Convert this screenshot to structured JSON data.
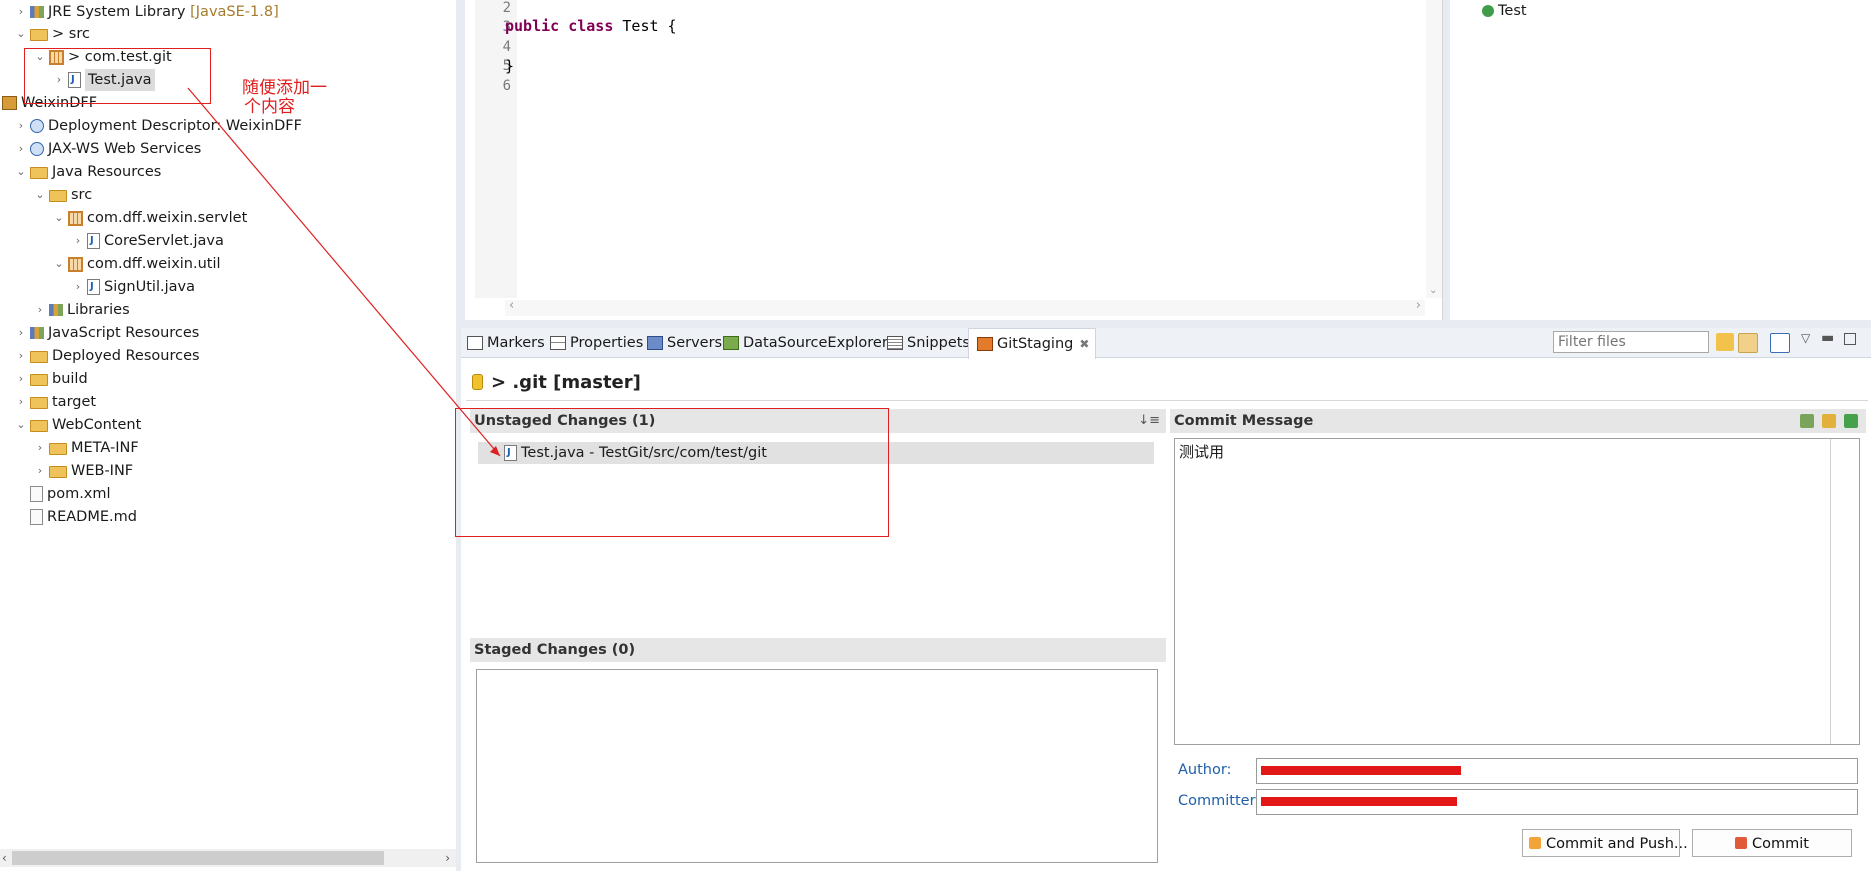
{
  "explorer": {
    "items": [
      {
        "label": "JRE System Library",
        "suffix": "[JavaSE-1.8]"
      },
      {
        "label": "> src"
      },
      {
        "label": "> com.test.git"
      },
      {
        "label": "Test.java"
      },
      {
        "label": "WeixinDFF"
      },
      {
        "label": "Deployment Descriptor: WeixinDFF"
      },
      {
        "label": "JAX-WS Web Services"
      },
      {
        "label": "Java Resources"
      },
      {
        "label": "src"
      },
      {
        "label": "com.dff.weixin.servlet"
      },
      {
        "label": "CoreServlet.java"
      },
      {
        "label": "com.dff.weixin.util"
      },
      {
        "label": "SignUtil.java"
      },
      {
        "label": "Libraries"
      },
      {
        "label": "JavaScript Resources"
      },
      {
        "label": "Deployed Resources"
      },
      {
        "label": "build"
      },
      {
        "label": "target"
      },
      {
        "label": "WebContent"
      },
      {
        "label": "META-INF"
      },
      {
        "label": "WEB-INF"
      },
      {
        "label": "pom.xml"
      },
      {
        "label": "README.md"
      }
    ]
  },
  "annotation": {
    "text_line1": "随便添加一",
    "text_line2": "个内容"
  },
  "editor": {
    "line_numbers": [
      "2",
      "3",
      "4",
      "5",
      "6"
    ],
    "code_keyword1": "public",
    "code_keyword2": "class",
    "code_rest": " Test {",
    "code_close": "}"
  },
  "outline": {
    "item": "Test"
  },
  "tabs": [
    {
      "label": "Markers",
      "icon": "markers-icon"
    },
    {
      "label": "Properties",
      "icon": "properties-icon"
    },
    {
      "label": "Servers",
      "icon": "servers-icon"
    },
    {
      "label": "DataSourceExplorer",
      "icon": "datasource-icon"
    },
    {
      "label": "Snippets",
      "icon": "snippets-icon"
    },
    {
      "label": "GitStaging",
      "icon": "git-icon",
      "active": true
    }
  ],
  "filter": {
    "placeholder": "Filter files"
  },
  "staging": {
    "repo_title": "> .git [master]",
    "unstaged_header": "Unstaged Changes (1)",
    "unstaged_items": [
      "Test.java - TestGit/src/com/test/git"
    ],
    "staged_header": "Staged Changes (0)",
    "commit_header": "Commit Message",
    "commit_message": "测试用",
    "author_label": "Author:",
    "committer_label": "Committer:",
    "commit_push_label": "Commit and Push...",
    "commit_label": "Commit"
  },
  "colors": {
    "accent_red": "#e02020",
    "label_blue": "#1f5fa8"
  }
}
